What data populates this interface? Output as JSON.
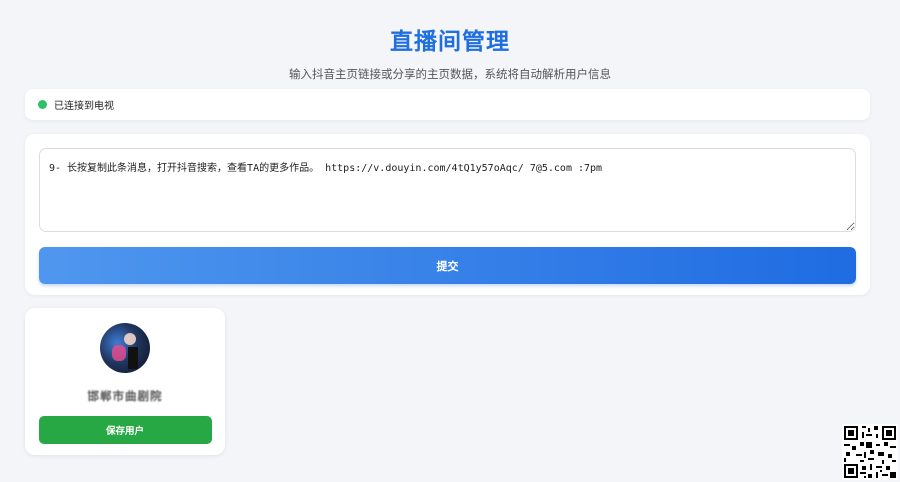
{
  "header": {
    "title": "直播间管理",
    "subtitle": "输入抖音主页链接或分享的主页数据，系统将自动解析用户信息"
  },
  "status": {
    "text": "已连接到电视",
    "color": "#2cc06a"
  },
  "share_form": {
    "input_value": "9- 长按复制此条消息，打开抖音搜索，查看TA的更多作品。 https://v.douyin.com/4tQ1y57oAqc/ 7@5.com :7pm",
    "submit_label": "提交",
    "accent_color": "#1f6ce2"
  },
  "user_card": {
    "name": "邯郸市曲剧院",
    "save_label": "保存用户",
    "save_color": "#28a745"
  },
  "icons": {
    "status": "status-dot-icon",
    "avatar": "user-avatar",
    "corner": "qr-code-icon"
  }
}
